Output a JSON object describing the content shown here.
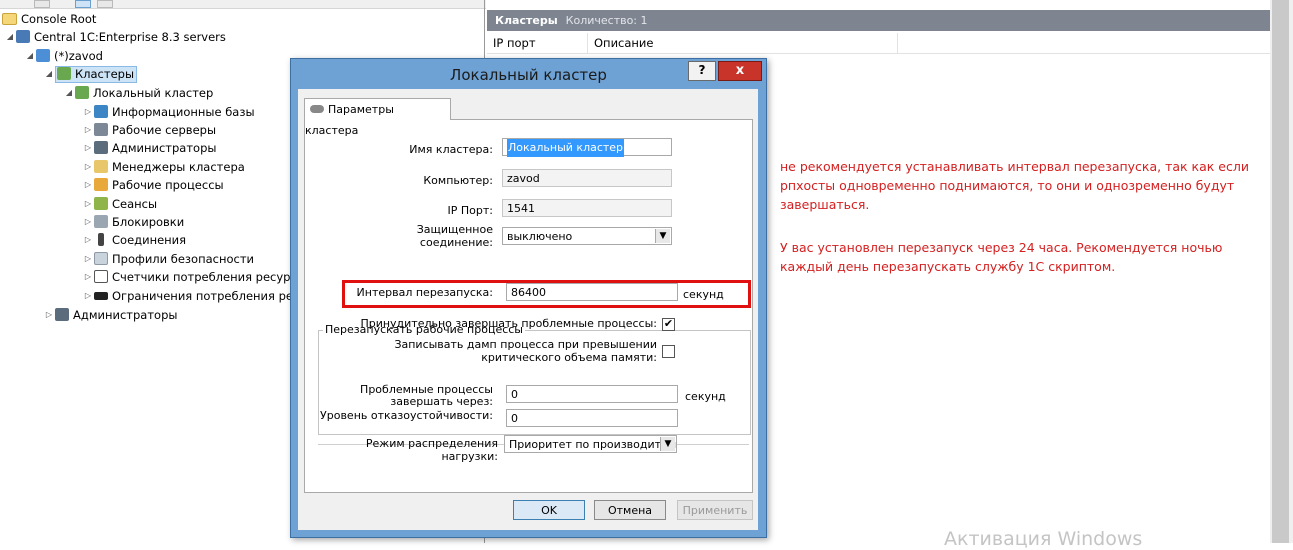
{
  "tree": {
    "root": "Console Root",
    "central": "Central 1C:Enterprise 8.3 servers",
    "server": "(*)zavod",
    "clusters": "Кластеры",
    "local_cluster": "Локальный кластер",
    "children": [
      "Информационные базы",
      "Рабочие серверы",
      "Администраторы",
      "Менеджеры кластера",
      "Рабочие процессы",
      "Сеансы",
      "Блокировки",
      "Соединения",
      "Профили безопасности",
      "Счетчики потребления ресурсов",
      "Ограничения потребления ресурсов"
    ],
    "admins": "Администраторы"
  },
  "right_pane": {
    "header_title": "Кластеры",
    "header_count": "Количество: 1",
    "columns": [
      "IP порт",
      "Описание"
    ]
  },
  "annotation": {
    "para1": "не рекомендуется устанавливать интервал перезапуска, так как если рпхосты одновременно поднимаются, то они и однозременно будут завершаться.",
    "para2": "У вас установлен перезапуск через 24 часа. Рекомендуется ночью каждый день перезапускать службу 1С скриптом.",
    "color": "#d42020"
  },
  "watermark": "Активация Windows",
  "dialog": {
    "title": "Локальный кластер",
    "help": "?",
    "close": "x",
    "tab": "Параметры кластера",
    "cluster_name_label": "Имя кластера:",
    "cluster_name_value": "Локальный кластер",
    "computer_label": "Компьютер:",
    "computer_value": "zavod",
    "ip_port_label": "IP Порт:",
    "ip_port_value": "1541",
    "secure_label": "Защищенное соединение:",
    "secure_value": "выключено",
    "group_title": "Перезапускать рабочие процессы",
    "interval_label": "Интервал перезапуска:",
    "interval_value": "86400",
    "interval_unit": "секунд",
    "force_label": "Принудительно завершать проблемные процессы:",
    "force_checked": true,
    "dump_label": "Записывать дамп процесса при превышении критического объема памяти:",
    "dump_checked": false,
    "problem_label": "Проблемные процессы завершать через:",
    "problem_value": "0",
    "problem_unit": "секунд",
    "fault_label": "Уровень отказоустойчивости:",
    "fault_value": "0",
    "load_label": "Режим распределения нагрузки:",
    "load_value": "Приоритет по производитель",
    "ok": "OK",
    "cancel": "Отмена",
    "apply": "Применить",
    "highlight_color": "#e01010"
  }
}
